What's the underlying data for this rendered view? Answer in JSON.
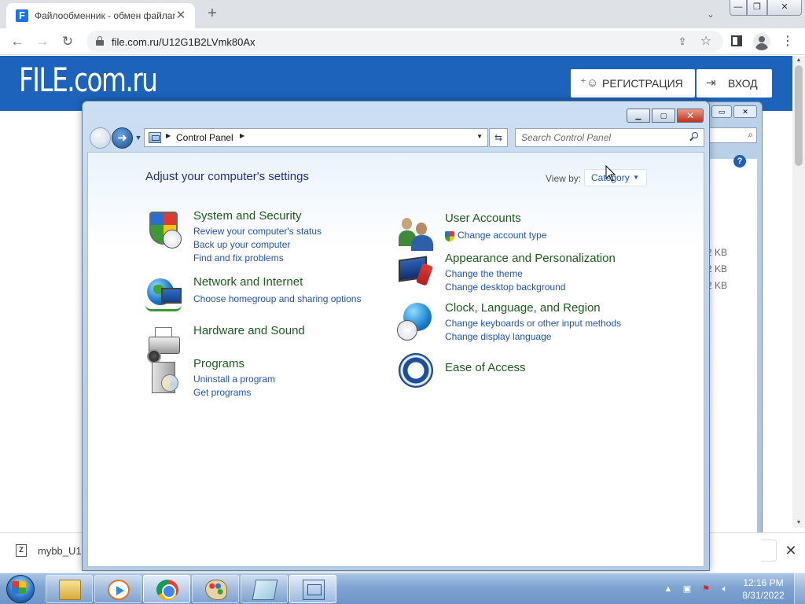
{
  "browser": {
    "tab_title": "Файлообменник - обмен файлами",
    "tab_favicon": "F",
    "tab_close_glyph": "✕",
    "new_tab_glyph": "+",
    "tab_search_glyph": "⌄",
    "url": "file.com.ru/U12G1B2LVmk80Ax",
    "back_glyph": "←",
    "forward_glyph": "→",
    "reload_glyph": "↻",
    "share_glyph": "⇪",
    "star_glyph": "☆",
    "menu_glyph": "⋮",
    "window_min_glyph": "—",
    "window_max_glyph": "❐",
    "window_close_glyph": "✕"
  },
  "site": {
    "logo": "FILE.com.ru",
    "register_label": "РЕГИСТРАЦИЯ",
    "register_icon": "person-add-icon",
    "login_label": "ВХОД",
    "login_icon": "login-icon",
    "header_color": "#1d63bb"
  },
  "background_window": {
    "sizes": [
      "2 KB",
      "2 KB",
      "2 KB"
    ]
  },
  "download_bar": {
    "file_name": "mybb_U1",
    "close_glyph": "✕"
  },
  "control_panel": {
    "breadcrumb": "Control Panel",
    "search_placeholder": "Search Control Panel",
    "heading": "Adjust your computer's settings",
    "view_by_label": "View by:",
    "view_by_value": "Category",
    "categories_left": [
      {
        "title": "System and Security",
        "icon": "shield-icon",
        "links": [
          "Review your computer's status",
          "Back up your computer",
          "Find and fix problems"
        ]
      },
      {
        "title": "Network and Internet",
        "icon": "network-globe-icon",
        "links": [
          "Choose homegroup and sharing options"
        ]
      },
      {
        "title": "Hardware and Sound",
        "icon": "printer-speaker-icon",
        "links": []
      },
      {
        "title": "Programs",
        "icon": "programs-box-icon",
        "links": [
          "Uninstall a program",
          "Get programs"
        ]
      }
    ],
    "categories_right": [
      {
        "title": "User Accounts",
        "icon": "users-icon",
        "links": [
          "Change account type"
        ]
      },
      {
        "title": "Appearance and Personalization",
        "icon": "appearance-monitor-icon",
        "links": [
          "Change the theme",
          "Change desktop background"
        ]
      },
      {
        "title": "Clock, Language, and Region",
        "icon": "clock-globe-icon",
        "links": [
          "Change keyboards or other input methods",
          "Change display language"
        ]
      },
      {
        "title": "Ease of Access",
        "icon": "ease-of-access-icon",
        "links": []
      }
    ],
    "title_color": "#1a5e1a",
    "link_color": "#1f55b5"
  },
  "taskbar": {
    "apps": [
      "Windows Explorer",
      "Windows Media Player",
      "Google Chrome",
      "Paint",
      "Notepad",
      "Control Panel"
    ],
    "active_app": "Control Panel",
    "clock_time": "12:16 PM",
    "clock_date": "8/31/2022"
  }
}
